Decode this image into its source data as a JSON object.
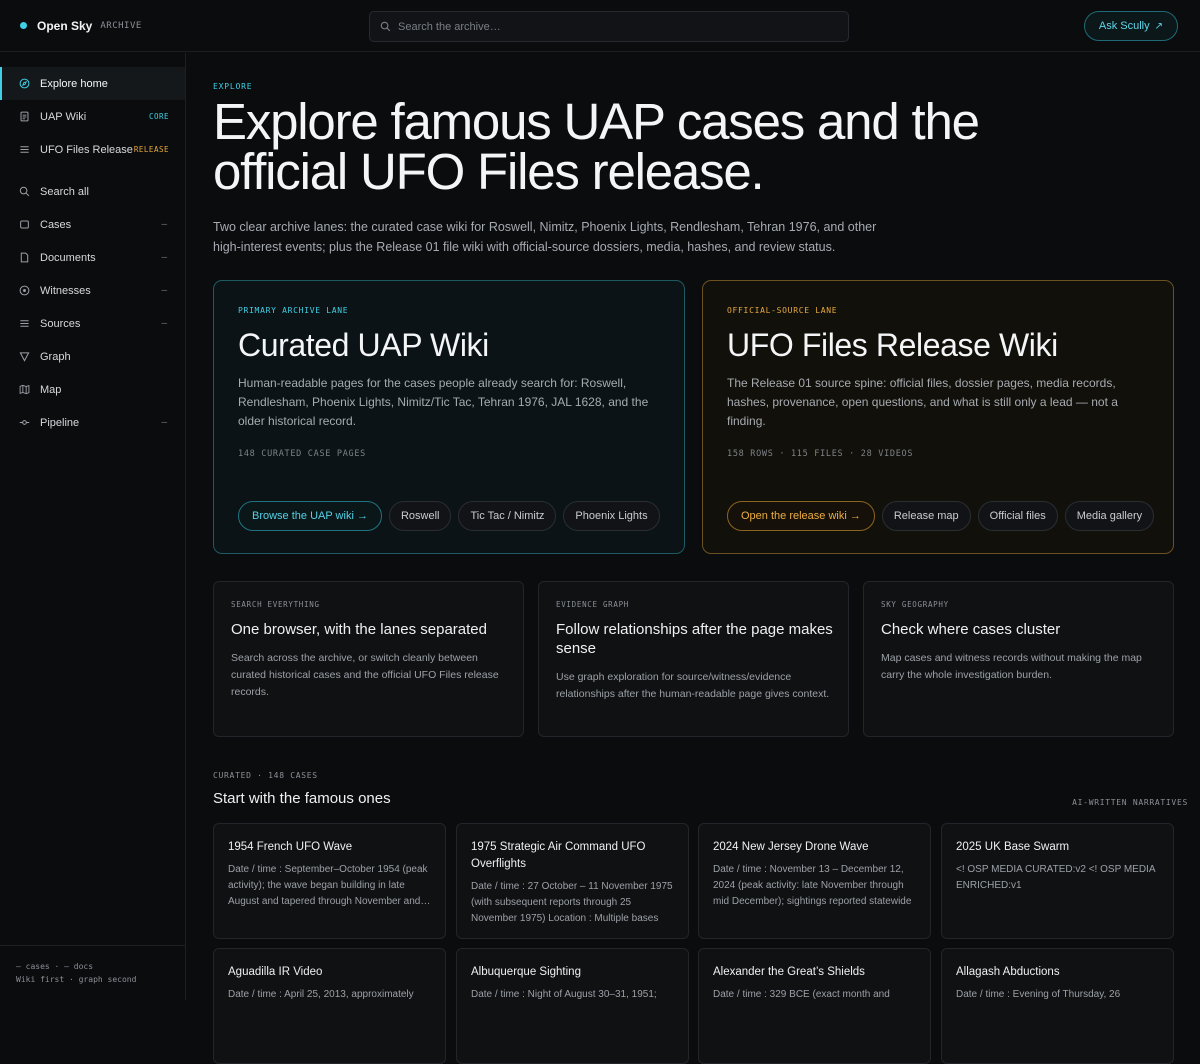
{
  "header": {
    "brand_name": "Open Sky",
    "brand_tag": "ARCHIVE",
    "search_placeholder": "Search the archive…",
    "ask_label": "Ask Scully",
    "ask_arrow": "↗"
  },
  "sidebar": {
    "primary": [
      {
        "label": "Explore home",
        "icon": "compass-icon",
        "active": true
      },
      {
        "label": "UAP Wiki",
        "icon": "document-icon",
        "badge": "CORE",
        "badge_color": "#3fd0e6"
      },
      {
        "label": "UFO Files Release",
        "icon": "list-icon",
        "badge": "RELEASE",
        "badge_color": "#e8a93c"
      }
    ],
    "secondary": [
      {
        "label": "Search all",
        "icon": "search-icon"
      },
      {
        "label": "Cases",
        "icon": "square-icon",
        "marker": "–"
      },
      {
        "label": "Documents",
        "icon": "file-icon",
        "marker": "–"
      },
      {
        "label": "Witnesses",
        "icon": "eye-icon",
        "marker": "–"
      },
      {
        "label": "Sources",
        "icon": "lines-icon",
        "marker": "–"
      },
      {
        "label": "Graph",
        "icon": "funnel-icon"
      },
      {
        "label": "Map",
        "icon": "map-icon"
      },
      {
        "label": "Pipeline",
        "icon": "pipeline-icon",
        "marker": "–"
      }
    ],
    "footer_line1": "– cases · – docs",
    "footer_line2": "Wiki first · graph second"
  },
  "hero": {
    "eyebrow": "EXPLORE",
    "title": "Explore famous UAP cases and the official UFO Files release.",
    "subtitle": "Two clear archive lanes: the curated case wiki for Roswell, Nimitz, Phoenix Lights, Rendlesham, Tehran 1976, and other high-interest events; plus the Release 01 file wiki with official-source dossiers, media, hashes, and review status."
  },
  "lanes": {
    "curated": {
      "tag": "PRIMARY ARCHIVE LANE",
      "title": "Curated UAP Wiki",
      "description": "Human-readable pages for the cases people already search for: Roswell, Rendlesham, Phoenix Lights, Nimitz/Tic Tac, Tehran 1976, JAL 1628, and the older historical record.",
      "stats": "148 CURATED CASE PAGES",
      "primary_button": "Browse the UAP wiki →",
      "pills": [
        "Roswell",
        "Tic Tac / Nimitz",
        "Phoenix Lights"
      ]
    },
    "release": {
      "tag": "OFFICIAL-SOURCE LANE",
      "title": "UFO Files Release Wiki",
      "description": "The Release 01 source spine: official files, dossier pages, media records, hashes, provenance, open questions, and what is still only a lead — not a finding.",
      "stats": "158 ROWS · 115 FILES · 28 VIDEOS",
      "primary_button": "Open the release wiki →",
      "pills": [
        "Release map",
        "Official files",
        "Media gallery"
      ]
    }
  },
  "features": [
    {
      "tag": "SEARCH EVERYTHING",
      "title": "One browser, with the lanes separated",
      "description": "Search across the archive, or switch cleanly between curated historical cases and the official UFO Files release records."
    },
    {
      "tag": "EVIDENCE GRAPH",
      "title": "Follow relationships after the page makes sense",
      "description": "Use graph exploration for source/witness/evidence relationships after the human-readable page gives context."
    },
    {
      "tag": "SKY GEOGRAPHY",
      "title": "Check where cases cluster",
      "description": "Map cases and witness records without making the map carry the whole investigation burden."
    }
  ],
  "cases_section": {
    "eyebrow": "CURATED · 148 CASES",
    "title": "Start with the famous ones",
    "right_label": "AI-WRITTEN NARRATIVES",
    "cases": [
      {
        "title": "1954 French UFO Wave",
        "description": "Date / time : September–October 1954 (peak activity); the wave began building in late August and tapered through November and beyond"
      },
      {
        "title": "1975 Strategic Air Command UFO Overflights",
        "description": "Date / time : 27 October – 11 November 1975 (with subsequent reports through 25 November 1975) Location : Multiple bases"
      },
      {
        "title": "2024 New Jersey Drone Wave",
        "description": "Date / time : November 13 – December 12, 2024 (peak activity: late November through mid December); sightings reported statewide"
      },
      {
        "title": "2025 UK Base Swarm",
        "description": "<! OSP MEDIA CURATED:v2 <! OSP MEDIA ENRICHED:v1"
      },
      {
        "title": "Aguadilla IR Video",
        "description": "Date / time : April 25, 2013, approximately"
      },
      {
        "title": "Albuquerque Sighting",
        "description": "Date / time : Night of August 30–31, 1951;"
      },
      {
        "title": "Alexander the Great’s Shields",
        "description": "Date / time : 329 BCE (exact month and"
      },
      {
        "title": "Allagash Abductions",
        "description": "Date / time : Evening of Thursday, 26"
      }
    ]
  }
}
